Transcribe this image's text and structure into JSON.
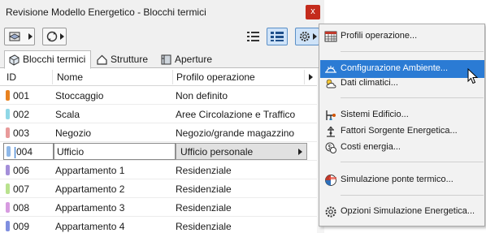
{
  "window": {
    "title": "Revisione Modello Energetico - Blocchi termici",
    "close_label": "x"
  },
  "tabs": [
    {
      "label": "Blocchi termici",
      "icon": "thermal-block-icon"
    },
    {
      "label": "Strutture",
      "icon": "house-structure-icon"
    },
    {
      "label": "Aperture",
      "icon": "window-opening-icon"
    }
  ],
  "table": {
    "headers": {
      "id": "ID",
      "name": "Nome",
      "profile": "Profilo operazione"
    },
    "rows": [
      {
        "id": "001",
        "name": "Stoccaggio",
        "profile": "Non definito",
        "color": "#e8821f"
      },
      {
        "id": "002",
        "name": "Scala",
        "profile": "Aree Circolazione e Traffico",
        "color": "#8fd7e6"
      },
      {
        "id": "003",
        "name": "Negozio",
        "profile": "Negozio/grande magazzino",
        "color": "#e89a9a"
      },
      {
        "id": "004",
        "name": "Ufficio",
        "profile": "Ufficio personale",
        "color": "#8fb8e8"
      },
      {
        "id": "006",
        "name": "Appartamento 1",
        "profile": "Residenziale",
        "color": "#a48fd9"
      },
      {
        "id": "007",
        "name": "Appartamento 2",
        "profile": "Residenziale",
        "color": "#b9e28e"
      },
      {
        "id": "008",
        "name": "Appartamento 3",
        "profile": "Residenziale",
        "color": "#d79be0"
      },
      {
        "id": "009",
        "name": "Appartamento 4",
        "profile": "Residenziale",
        "color": "#7f8fe0"
      }
    ]
  },
  "menu": {
    "items": [
      {
        "label": "Profili operazione...",
        "icon": "calendar-grid-icon"
      },
      {
        "label": "Configurazione Ambiente...",
        "icon": "environment-icon"
      },
      {
        "label": "Dati climatici...",
        "icon": "weather-icon"
      },
      {
        "label": "Sistemi Edificio...",
        "icon": "building-systems-icon"
      },
      {
        "label": "Fattori Sorgente Energetica...",
        "icon": "energy-source-icon"
      },
      {
        "label": "Costi energia...",
        "icon": "money-icon"
      },
      {
        "label": "Simulazione ponte termico...",
        "icon": "thermal-bridge-icon"
      },
      {
        "label": "Opzioni Simulazione Energetica...",
        "icon": "gear-icon"
      }
    ]
  },
  "colors": {
    "accent": "#2b7bd4",
    "close": "#c42b1c"
  }
}
